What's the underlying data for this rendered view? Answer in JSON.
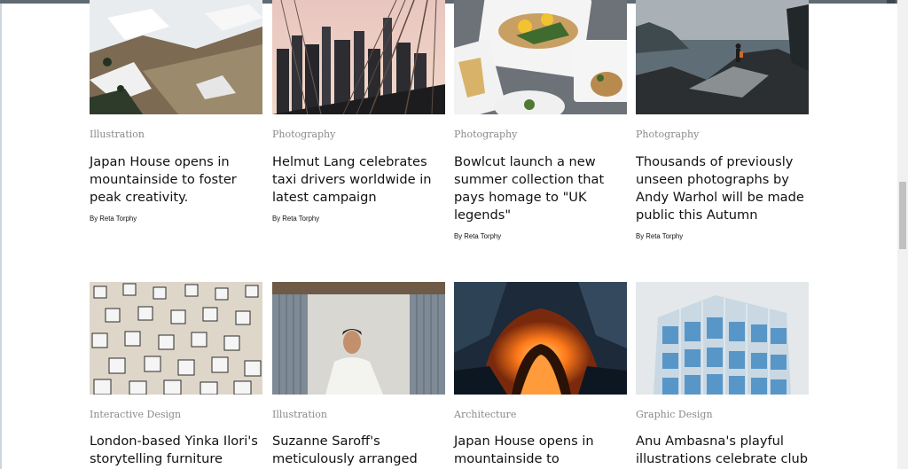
{
  "cards": [
    {
      "category": "Illustration",
      "title": "Japan House opens in mountainside to foster peak creativity.",
      "byline": "By Reta Torphy",
      "image": "snowy-mountain-photo"
    },
    {
      "category": "Photography",
      "title": "Helmut Lang celebrates taxi drivers worldwide in latest campaign",
      "byline": "By Reta Torphy",
      "image": "city-bridge-photo"
    },
    {
      "category": "Photography",
      "title": "Bowlcut launch a new summer collection that pays homage to \"UK legends\"",
      "byline": "By Reta Torphy",
      "image": "food-plates-photo"
    },
    {
      "category": "Photography",
      "title": "Thousands of previously unseen photographs by Andy Warhol will be made public this Autumn",
      "byline": "By Reta Torphy",
      "image": "coastal-hiker-photo"
    },
    {
      "category": "Interactive Design",
      "title": "London-based Yinka Ilori's storytelling furniture",
      "image": "beach-chairs-photo"
    },
    {
      "category": "Illustration",
      "title": "Suzanne Saroff's meticulously arranged",
      "image": "man-in-container-photo"
    },
    {
      "category": "Architecture",
      "title": "Japan House opens in mountainside to",
      "image": "glowing-tunnel-photo"
    },
    {
      "category": "Graphic Design",
      "title": "Anu Ambasna's playful illustrations celebrate club",
      "image": "glass-building-photo"
    }
  ]
}
